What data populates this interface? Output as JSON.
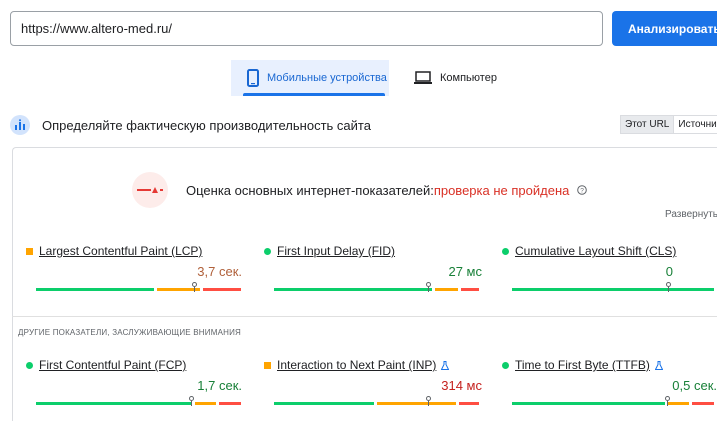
{
  "search": {
    "value": "https://www.altero-med.ru/",
    "button": "Анализировать"
  },
  "tabs": [
    {
      "label": "Мобильные устройства",
      "icon": "smartphone-icon",
      "selected": true
    },
    {
      "label": "Компьютер",
      "icon": "laptop-icon",
      "selected": false
    }
  ],
  "info": {
    "title": "Определяйте фактическую производительность сайта",
    "toggle": [
      "Этот URL",
      "Источни"
    ]
  },
  "assessment": {
    "prefix": "Оценка основных интернет-показателей:",
    "status": "проверка не пройдена",
    "expand": "Развернуть",
    "fail_color": "#d93025"
  },
  "core_metrics": [
    {
      "name": "Largest Contentful Paint (LCP)",
      "value": "3,7 сек.",
      "rating": "needs-improvement"
    },
    {
      "name": "First Input Delay (FID)",
      "value": "27 мс",
      "rating": "good"
    },
    {
      "name": "Cumulative Layout Shift (CLS)",
      "value": "0",
      "rating": "good"
    }
  ],
  "other_label": "ДРУГИЕ ПОКАЗАТЕЛИ, ЗАСЛУЖИВАЮЩИЕ ВНИМАНИЯ",
  "other_metrics": [
    {
      "name": "First Contentful Paint (FCP)",
      "value": "1,7 сек.",
      "rating": "good",
      "beta": false
    },
    {
      "name": "Interaction to Next Paint (INP)",
      "value": "314 мс",
      "rating": "needs-improvement",
      "beta": true
    },
    {
      "name": "Time to First Byte (TTFB)",
      "value": "0,5 сек.",
      "rating": "good",
      "beta": true
    }
  ],
  "colors": {
    "accent": "#1a73e8",
    "good": "#0cce6b",
    "needs_improvement": "#ffa400",
    "poor": "#ff4e42"
  }
}
